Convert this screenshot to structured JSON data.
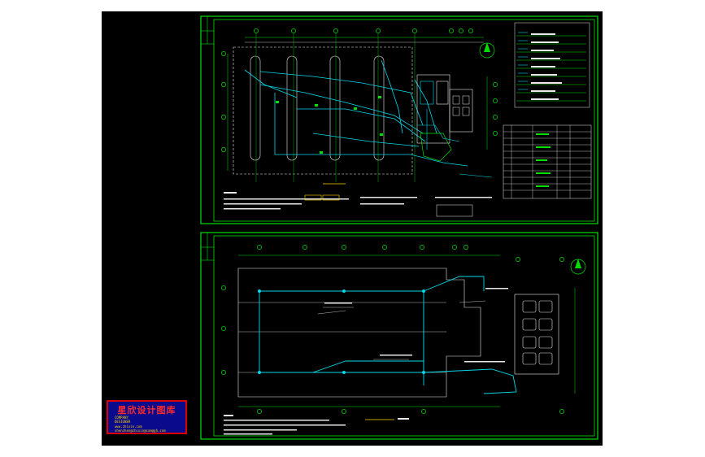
{
  "colors": {
    "background": "#ffffff",
    "canvas": "#000000",
    "frame": "#00e000",
    "pipe": "#00d8e8",
    "structure": "#e8e8e8",
    "grid": "#00c800",
    "accent_yellow": "#ffd400",
    "stamp_bg": "#0a0a8c",
    "stamp_border": "#dd0000",
    "stamp_title": "#ff2a2a"
  },
  "watermark": {
    "title": "星欣设计图库",
    "line1": "COMPANY",
    "line2": "DESIGNER",
    "line3": "www.zhixin.com",
    "line4": "shenzhen@zhixin@com@gh.com"
  }
}
